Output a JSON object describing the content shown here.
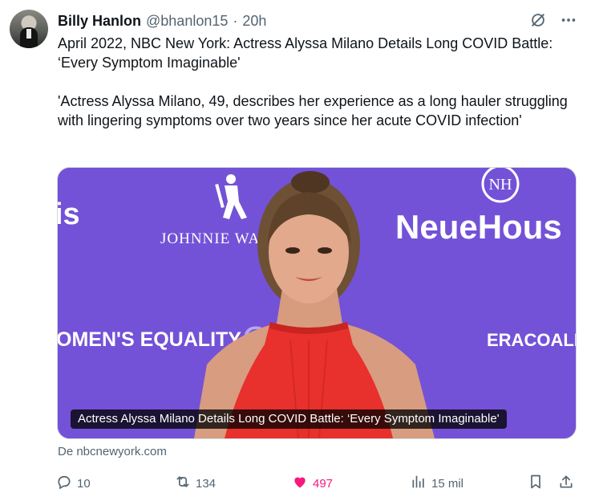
{
  "author": {
    "name": "Billy Hanlon",
    "handle": "@bhanlon15",
    "separator": "·",
    "time": "20h"
  },
  "tweet": {
    "paragraph1": "April 2022, NBC New York: Actress Alyssa Milano Details Long COVID Battle: ‘Every Symptom Imaginable'",
    "paragraph2": "'Actress Alyssa Milano, 49, describes her experience as a long hauler struggling with lingering symptoms over two years since her acute COVID infection'"
  },
  "card": {
    "caption": "Actress Alyssa Milano Details Long COVID Battle: ‘Every Symptom Imaginable'",
    "backdrop_text": {
      "johnnie": "JOHNNIE WA",
      "neuehouse": "NeueHous",
      "womens": "OMEN'S EQUALITY",
      "coalition": "ERACOALITIO",
      "crg": "CRG",
      "left_fragment": "is",
      "monogram": "NH"
    },
    "background_color": "#6f4fd3",
    "dress_color": "#e8302c"
  },
  "source": "De nbcnewyork.com",
  "actions": {
    "replies": "10",
    "reposts": "134",
    "likes": "497",
    "views": "15 mil"
  },
  "icons": [
    "grok-icon",
    "more-icon",
    "reply-icon",
    "repost-icon",
    "like-icon",
    "views-icon",
    "bookmark-icon",
    "share-icon"
  ],
  "colors": {
    "like": "#f91880",
    "muted": "#536471",
    "text": "#0f1419"
  }
}
